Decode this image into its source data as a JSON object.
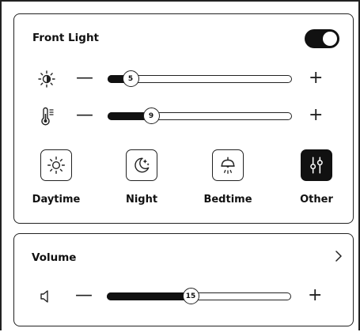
{
  "front_light": {
    "title": "Front Light",
    "toggle_on": true,
    "brightness": {
      "value": "5",
      "fraction": 0.12,
      "icon": "brightness-icon"
    },
    "warmth": {
      "value": "9",
      "fraction": 0.23,
      "icon": "thermometer-icon"
    },
    "minus_label": "—",
    "plus_label": "+",
    "modes": [
      {
        "label": "Daytime",
        "icon": "sun-icon",
        "active": false
      },
      {
        "label": "Night",
        "icon": "moon-stars-icon",
        "active": false
      },
      {
        "label": "Bedtime",
        "icon": "lamp-icon",
        "active": false
      },
      {
        "label": "Other",
        "icon": "sliders-icon",
        "active": true
      }
    ]
  },
  "volume": {
    "title": "Volume",
    "value": "15",
    "fraction": 0.45,
    "icon": "speaker-icon",
    "minus_label": "—",
    "plus_label": "+"
  },
  "colors": {
    "accent": "#111111",
    "border": "#222222",
    "background": "#ffffff"
  }
}
